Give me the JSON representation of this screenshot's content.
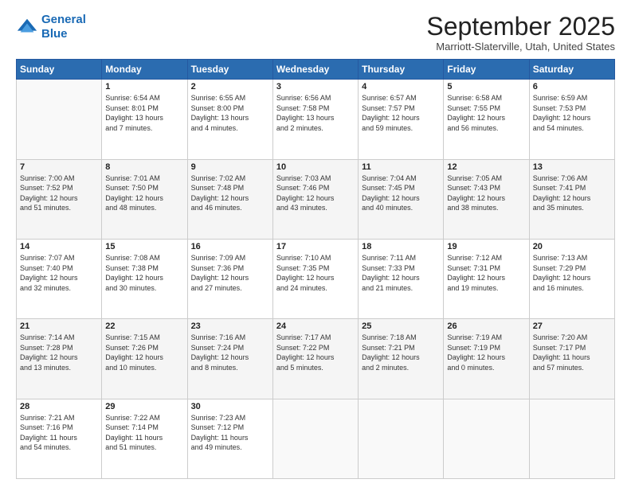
{
  "logo": {
    "line1": "General",
    "line2": "Blue"
  },
  "title": "September 2025",
  "subtitle": "Marriott-Slaterville, Utah, United States",
  "days_header": [
    "Sunday",
    "Monday",
    "Tuesday",
    "Wednesday",
    "Thursday",
    "Friday",
    "Saturday"
  ],
  "weeks": [
    [
      {
        "num": "",
        "info": ""
      },
      {
        "num": "1",
        "info": "Sunrise: 6:54 AM\nSunset: 8:01 PM\nDaylight: 13 hours\nand 7 minutes."
      },
      {
        "num": "2",
        "info": "Sunrise: 6:55 AM\nSunset: 8:00 PM\nDaylight: 13 hours\nand 4 minutes."
      },
      {
        "num": "3",
        "info": "Sunrise: 6:56 AM\nSunset: 7:58 PM\nDaylight: 13 hours\nand 2 minutes."
      },
      {
        "num": "4",
        "info": "Sunrise: 6:57 AM\nSunset: 7:57 PM\nDaylight: 12 hours\nand 59 minutes."
      },
      {
        "num": "5",
        "info": "Sunrise: 6:58 AM\nSunset: 7:55 PM\nDaylight: 12 hours\nand 56 minutes."
      },
      {
        "num": "6",
        "info": "Sunrise: 6:59 AM\nSunset: 7:53 PM\nDaylight: 12 hours\nand 54 minutes."
      }
    ],
    [
      {
        "num": "7",
        "info": "Sunrise: 7:00 AM\nSunset: 7:52 PM\nDaylight: 12 hours\nand 51 minutes."
      },
      {
        "num": "8",
        "info": "Sunrise: 7:01 AM\nSunset: 7:50 PM\nDaylight: 12 hours\nand 48 minutes."
      },
      {
        "num": "9",
        "info": "Sunrise: 7:02 AM\nSunset: 7:48 PM\nDaylight: 12 hours\nand 46 minutes."
      },
      {
        "num": "10",
        "info": "Sunrise: 7:03 AM\nSunset: 7:46 PM\nDaylight: 12 hours\nand 43 minutes."
      },
      {
        "num": "11",
        "info": "Sunrise: 7:04 AM\nSunset: 7:45 PM\nDaylight: 12 hours\nand 40 minutes."
      },
      {
        "num": "12",
        "info": "Sunrise: 7:05 AM\nSunset: 7:43 PM\nDaylight: 12 hours\nand 38 minutes."
      },
      {
        "num": "13",
        "info": "Sunrise: 7:06 AM\nSunset: 7:41 PM\nDaylight: 12 hours\nand 35 minutes."
      }
    ],
    [
      {
        "num": "14",
        "info": "Sunrise: 7:07 AM\nSunset: 7:40 PM\nDaylight: 12 hours\nand 32 minutes."
      },
      {
        "num": "15",
        "info": "Sunrise: 7:08 AM\nSunset: 7:38 PM\nDaylight: 12 hours\nand 30 minutes."
      },
      {
        "num": "16",
        "info": "Sunrise: 7:09 AM\nSunset: 7:36 PM\nDaylight: 12 hours\nand 27 minutes."
      },
      {
        "num": "17",
        "info": "Sunrise: 7:10 AM\nSunset: 7:35 PM\nDaylight: 12 hours\nand 24 minutes."
      },
      {
        "num": "18",
        "info": "Sunrise: 7:11 AM\nSunset: 7:33 PM\nDaylight: 12 hours\nand 21 minutes."
      },
      {
        "num": "19",
        "info": "Sunrise: 7:12 AM\nSunset: 7:31 PM\nDaylight: 12 hours\nand 19 minutes."
      },
      {
        "num": "20",
        "info": "Sunrise: 7:13 AM\nSunset: 7:29 PM\nDaylight: 12 hours\nand 16 minutes."
      }
    ],
    [
      {
        "num": "21",
        "info": "Sunrise: 7:14 AM\nSunset: 7:28 PM\nDaylight: 12 hours\nand 13 minutes."
      },
      {
        "num": "22",
        "info": "Sunrise: 7:15 AM\nSunset: 7:26 PM\nDaylight: 12 hours\nand 10 minutes."
      },
      {
        "num": "23",
        "info": "Sunrise: 7:16 AM\nSunset: 7:24 PM\nDaylight: 12 hours\nand 8 minutes."
      },
      {
        "num": "24",
        "info": "Sunrise: 7:17 AM\nSunset: 7:22 PM\nDaylight: 12 hours\nand 5 minutes."
      },
      {
        "num": "25",
        "info": "Sunrise: 7:18 AM\nSunset: 7:21 PM\nDaylight: 12 hours\nand 2 minutes."
      },
      {
        "num": "26",
        "info": "Sunrise: 7:19 AM\nSunset: 7:19 PM\nDaylight: 12 hours\nand 0 minutes."
      },
      {
        "num": "27",
        "info": "Sunrise: 7:20 AM\nSunset: 7:17 PM\nDaylight: 11 hours\nand 57 minutes."
      }
    ],
    [
      {
        "num": "28",
        "info": "Sunrise: 7:21 AM\nSunset: 7:16 PM\nDaylight: 11 hours\nand 54 minutes."
      },
      {
        "num": "29",
        "info": "Sunrise: 7:22 AM\nSunset: 7:14 PM\nDaylight: 11 hours\nand 51 minutes."
      },
      {
        "num": "30",
        "info": "Sunrise: 7:23 AM\nSunset: 7:12 PM\nDaylight: 11 hours\nand 49 minutes."
      },
      {
        "num": "",
        "info": ""
      },
      {
        "num": "",
        "info": ""
      },
      {
        "num": "",
        "info": ""
      },
      {
        "num": "",
        "info": ""
      }
    ]
  ]
}
